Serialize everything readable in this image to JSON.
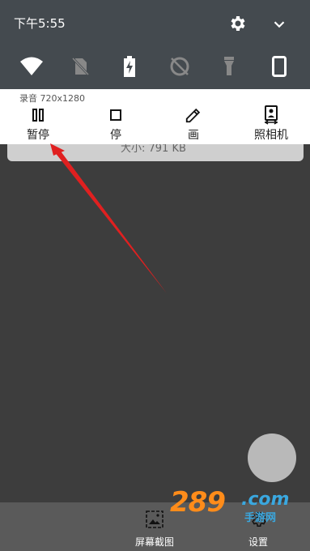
{
  "status_bar": {
    "time": "下午5:55"
  },
  "quick_settings": {
    "tiles": [
      "wifi-icon",
      "no-sim-icon",
      "battery-charging-icon",
      "data-saver-off-icon",
      "flashlight-icon",
      "device-icon"
    ]
  },
  "notification": {
    "title": "录音 720x1280",
    "actions": [
      {
        "label": "暂停",
        "icon": "pause-icon"
      },
      {
        "label": "停",
        "icon": "stop-icon"
      },
      {
        "label": "画",
        "icon": "pencil-icon"
      },
      {
        "label": "照相机",
        "icon": "camera-icon"
      }
    ]
  },
  "peek_card": {
    "text": "大小: 791 KB"
  },
  "bottom_bar": {
    "items": [
      {
        "label": "屏幕截图",
        "icon": "screenshot-icon"
      },
      {
        "label": "设置",
        "icon": "settings-icon"
      }
    ]
  },
  "watermark": {
    "number": "289",
    "domain": ".com",
    "sub": "手游网"
  },
  "colors": {
    "shade": "#444a4f",
    "background": "#3d3d3d",
    "arrow": "#e02020",
    "watermark_orange": "#ff8c1a",
    "watermark_blue": "#3aa8e0"
  }
}
